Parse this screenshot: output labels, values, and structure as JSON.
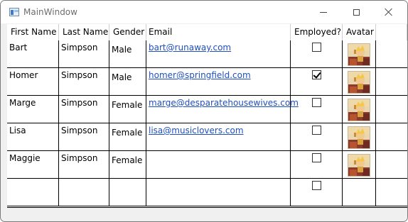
{
  "window": {
    "title": "MainWindow"
  },
  "grid": {
    "columns": [
      "First Name",
      "Last Name",
      "Gender",
      "Email",
      "Employed?",
      "Avatar"
    ],
    "rows": [
      {
        "first": "Bart",
        "last": "Simpson",
        "gender": "Male",
        "email": "bart@runaway.com",
        "employed": false,
        "avatar": true
      },
      {
        "first": "Homer",
        "last": "Simpson",
        "gender": "Male",
        "email": "homer@springfield.com",
        "employed": true,
        "avatar": true
      },
      {
        "first": "Marge",
        "last": "Simpson",
        "gender": "Female",
        "email": "marge@desparatehousewives.com",
        "employed": false,
        "avatar": true
      },
      {
        "first": "Lisa",
        "last": "Simpson",
        "gender": "Female",
        "email": "lisa@musiclovers.com",
        "employed": false,
        "avatar": true
      },
      {
        "first": "Maggie",
        "last": "Simpson",
        "gender": "Female",
        "email": "",
        "employed": false,
        "avatar": true
      },
      {
        "first": "",
        "last": "",
        "gender": "",
        "email": "",
        "employed": false,
        "avatar": false
      }
    ]
  },
  "colors": {
    "link": "#1f4fbf",
    "gridline": "#000000"
  },
  "icons": {
    "app": "window-app-icon",
    "minimize": "minimize-icon",
    "maximize": "maximize-icon",
    "close": "close-icon",
    "avatar": "avatar-image",
    "check": "checkmark-icon"
  }
}
